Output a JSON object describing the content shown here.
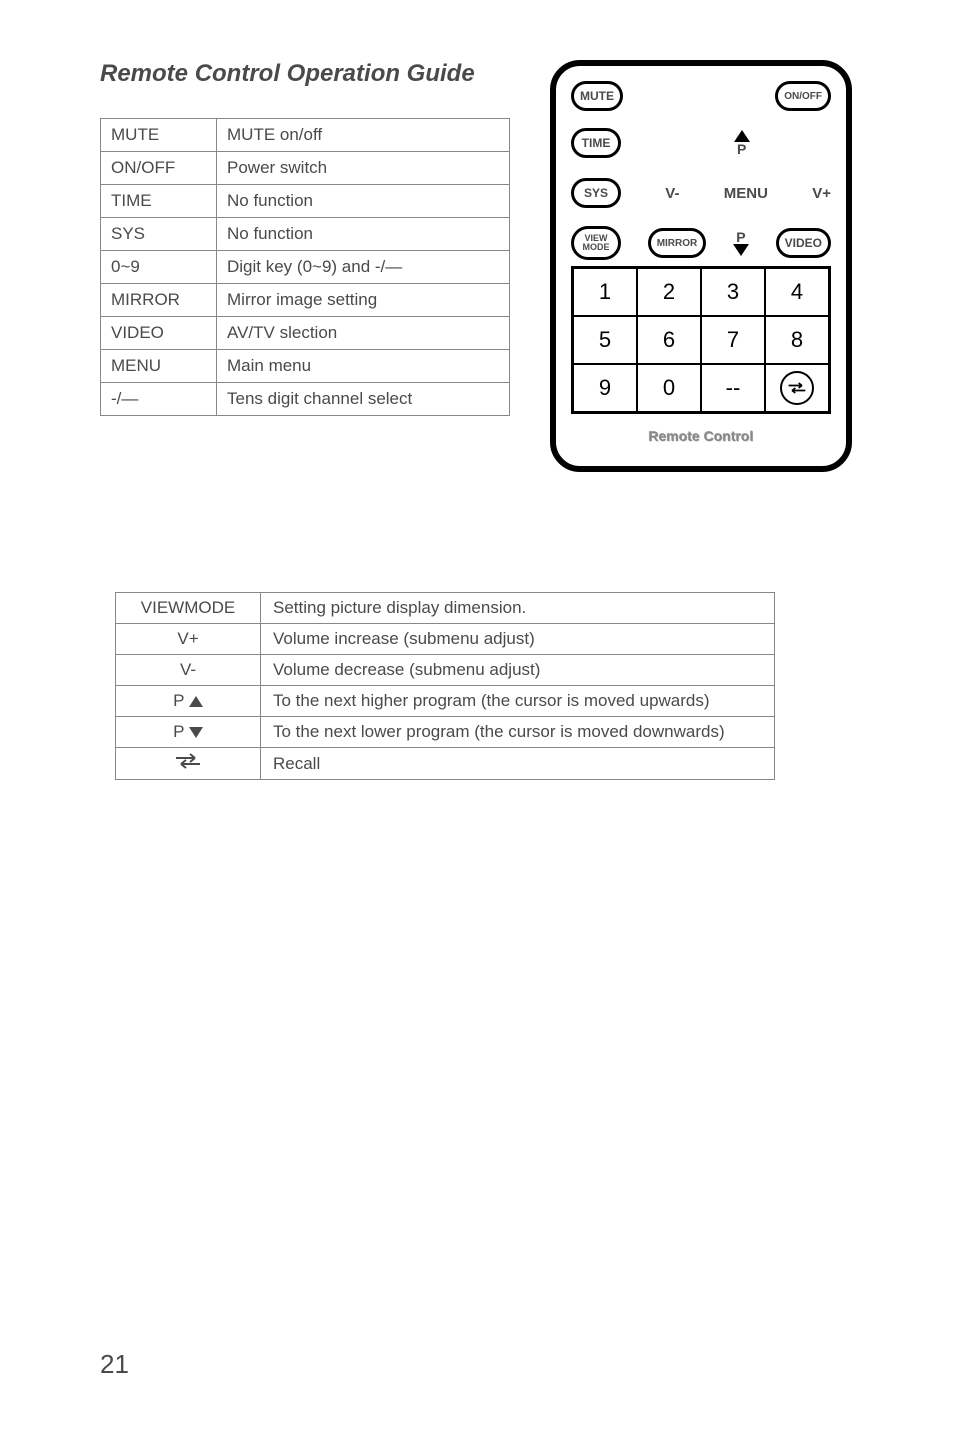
{
  "title": "Remote Control Operation Guide",
  "table1": [
    {
      "key": "MUTE",
      "desc": "MUTE on/off"
    },
    {
      "key": "ON/OFF",
      "desc": "Power switch"
    },
    {
      "key": "TIME",
      "desc": "No function"
    },
    {
      "key": "SYS",
      "desc": "No function"
    },
    {
      "key": "0~9",
      "desc": "Digit key (0~9) and -/—"
    },
    {
      "key": "MIRROR",
      "desc": "Mirror image setting"
    },
    {
      "key": "VIDEO",
      "desc": "AV/TV slection"
    },
    {
      "key": "MENU",
      "desc": "Main menu"
    },
    {
      "key": "-/—",
      "desc": "Tens digit channel select"
    }
  ],
  "table2": [
    {
      "key": "VIEWMODE",
      "desc": "Setting picture display dimension."
    },
    {
      "key": "V+",
      "desc": "Volume increase (submenu adjust)"
    },
    {
      "key": "V-",
      "desc": "Volume decrease (submenu adjust)"
    },
    {
      "key": "P ▲",
      "desc": "To the next higher program (the cursor is moved upwards)"
    },
    {
      "key": "P ▼",
      "desc": "To the next lower program (the cursor is moved downwards)"
    },
    {
      "key": "RECALL",
      "desc": "Recall"
    }
  ],
  "remote": {
    "mute": "MUTE",
    "onoff": "ON/OFF",
    "time": "TIME",
    "p_label": "P",
    "sys": "SYS",
    "v_minus": "V-",
    "menu": "MENU",
    "v_plus": "V+",
    "viewmode_l1": "VIEW",
    "viewmode_l2": "MODE",
    "mirror": "MIRROR",
    "p_label2": "P",
    "video": "VIDEO",
    "digits": [
      "1",
      "2",
      "3",
      "4",
      "5",
      "6",
      "7",
      "8",
      "9",
      "0",
      "--"
    ],
    "label": "Remote Control"
  },
  "page_number": "21"
}
